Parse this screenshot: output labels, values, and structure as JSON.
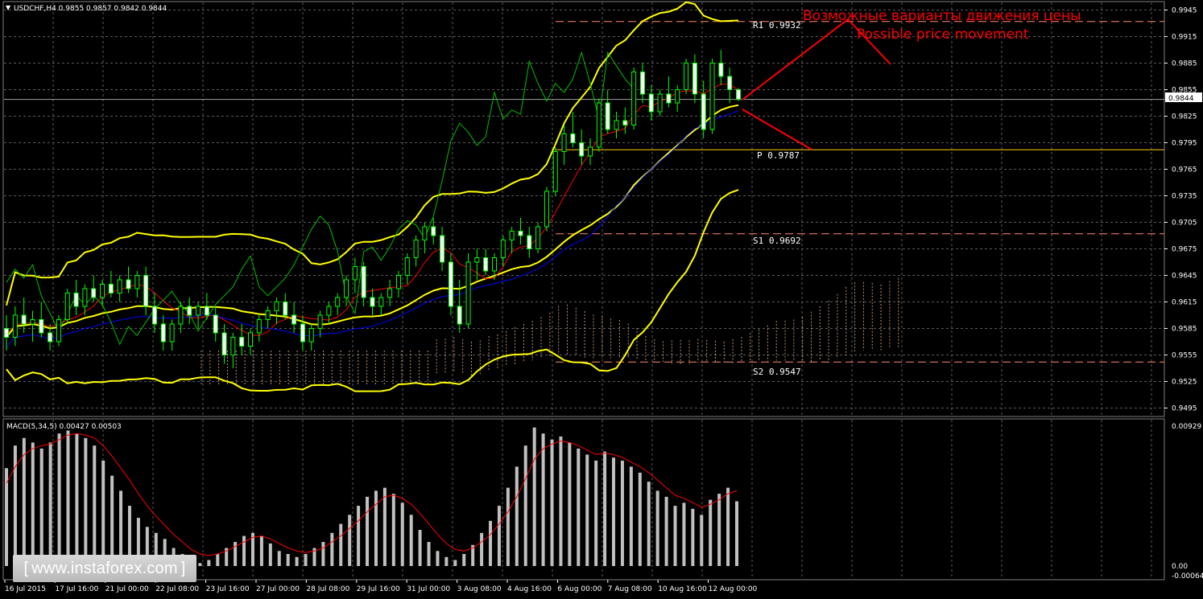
{
  "header": {
    "symbol_info": "USDCHF,H4  0.9855 0.9857 0.9842 0.9844",
    "macd_info": "MACD(5,34,5) 0.00427 0.00503"
  },
  "annotation": {
    "title_ru": "Возможные варианты движения цены",
    "title_en": "Possible price movement"
  },
  "levels": {
    "r1": "R1  0.9932",
    "p": "P  0.9787",
    "s1": "S1  0.9692",
    "s2": "S2  0.9547"
  },
  "price_axis": [
    "0.9945",
    "0.9915",
    "0.9885",
    "0.9855",
    "0.9825",
    "0.9795",
    "0.9765",
    "0.9735",
    "0.9705",
    "0.9675",
    "0.9645",
    "0.9615",
    "0.9585",
    "0.9555",
    "0.9525",
    "0.9495"
  ],
  "current_price": "0.9844",
  "macd_axis": [
    "0.00929",
    "0.00",
    "-0.00064"
  ],
  "time_axis": [
    "16 Jul 2015",
    "17 Jul 16:00",
    "21 Jul 00:00",
    "22 Jul 08:00",
    "23 Jul 16:00",
    "27 Jul 00:00",
    "28 Jul 08:00",
    "29 Jul 16:00",
    "31 Jul 00:00",
    "3 Aug 08:00",
    "4 Aug 16:00",
    "6 Aug 00:00",
    "7 Aug 08:00",
    "10 Aug 16:00",
    "12 Aug 00:00"
  ],
  "watermark": {
    "text": "www.instaforex.com",
    "open": "[",
    "close": "]"
  },
  "colors": {
    "background": "#000000",
    "bollinger": "#ffff00",
    "tenkan": "#ff0000",
    "kijun": "#0000ff",
    "chikou": "#00c000",
    "cloud": "#ffc090",
    "annotation": "#ff0000",
    "pivot": "#ffcc00",
    "macd_hist": "#c0c0c0",
    "macd_signal": "#ff0000"
  },
  "chart_data": {
    "type": "line",
    "price_range": [
      0.949,
      0.995
    ],
    "macd_range": [
      -0.00064,
      0.00929
    ],
    "pivot_levels": {
      "R1": 0.9932,
      "P": 0.9787,
      "S1": 0.9692,
      "S2": 0.9547
    },
    "current": 0.9844,
    "candles": [
      [
        0.9585,
        0.96,
        0.956,
        0.9575
      ],
      [
        0.9575,
        0.961,
        0.9565,
        0.96
      ],
      [
        0.96,
        0.962,
        0.958,
        0.959
      ],
      [
        0.959,
        0.9605,
        0.957,
        0.9595
      ],
      [
        0.9595,
        0.9615,
        0.9575,
        0.958
      ],
      [
        0.958,
        0.959,
        0.956,
        0.957
      ],
      [
        0.957,
        0.96,
        0.9565,
        0.9595
      ],
      [
        0.9595,
        0.963,
        0.959,
        0.9625
      ],
      [
        0.9625,
        0.964,
        0.96,
        0.961
      ],
      [
        0.961,
        0.9635,
        0.96,
        0.963
      ],
      [
        0.963,
        0.9645,
        0.9615,
        0.962
      ],
      [
        0.962,
        0.964,
        0.961,
        0.9635
      ],
      [
        0.9635,
        0.965,
        0.962,
        0.9625
      ],
      [
        0.9625,
        0.9645,
        0.9615,
        0.964
      ],
      [
        0.964,
        0.9655,
        0.9625,
        0.963
      ],
      [
        0.963,
        0.965,
        0.962,
        0.9645
      ],
      [
        0.9645,
        0.9655,
        0.96,
        0.961
      ],
      [
        0.961,
        0.9625,
        0.958,
        0.959
      ],
      [
        0.959,
        0.96,
        0.956,
        0.957
      ],
      [
        0.957,
        0.9595,
        0.956,
        0.959
      ],
      [
        0.959,
        0.9615,
        0.958,
        0.961
      ],
      [
        0.961,
        0.962,
        0.959,
        0.96
      ],
      [
        0.96,
        0.9615,
        0.9585,
        0.961
      ],
      [
        0.961,
        0.9625,
        0.9595,
        0.96
      ],
      [
        0.96,
        0.961,
        0.957,
        0.958
      ],
      [
        0.958,
        0.959,
        0.9545,
        0.9555
      ],
      [
        0.9555,
        0.958,
        0.954,
        0.9575
      ],
      [
        0.9575,
        0.959,
        0.9555,
        0.9565
      ],
      [
        0.9565,
        0.9585,
        0.9555,
        0.958
      ],
      [
        0.958,
        0.96,
        0.957,
        0.9595
      ],
      [
        0.9595,
        0.961,
        0.9585,
        0.9605
      ],
      [
        0.9605,
        0.962,
        0.959,
        0.9615
      ],
      [
        0.9615,
        0.9625,
        0.9595,
        0.96
      ],
      [
        0.96,
        0.9615,
        0.958,
        0.959
      ],
      [
        0.959,
        0.96,
        0.956,
        0.957
      ],
      [
        0.957,
        0.959,
        0.956,
        0.9585
      ],
      [
        0.9585,
        0.9605,
        0.9575,
        0.96
      ],
      [
        0.96,
        0.9615,
        0.959,
        0.961
      ],
      [
        0.961,
        0.9625,
        0.96,
        0.962
      ],
      [
        0.962,
        0.9645,
        0.961,
        0.964
      ],
      [
        0.964,
        0.9665,
        0.9625,
        0.9655
      ],
      [
        0.9655,
        0.966,
        0.961,
        0.962
      ],
      [
        0.962,
        0.963,
        0.96,
        0.961
      ],
      [
        0.961,
        0.9625,
        0.96,
        0.962
      ],
      [
        0.962,
        0.964,
        0.961,
        0.963
      ],
      [
        0.963,
        0.965,
        0.962,
        0.9645
      ],
      [
        0.9645,
        0.967,
        0.9635,
        0.9665
      ],
      [
        0.9665,
        0.969,
        0.9655,
        0.9685
      ],
      [
        0.9685,
        0.9705,
        0.967,
        0.97
      ],
      [
        0.97,
        0.971,
        0.968,
        0.969
      ],
      [
        0.969,
        0.97,
        0.965,
        0.966
      ],
      [
        0.966,
        0.967,
        0.96,
        0.961
      ],
      [
        0.961,
        0.964,
        0.958,
        0.959
      ],
      [
        0.959,
        0.967,
        0.9585,
        0.966
      ],
      [
        0.966,
        0.9675,
        0.964,
        0.9665
      ],
      [
        0.9665,
        0.9675,
        0.9645,
        0.965
      ],
      [
        0.965,
        0.967,
        0.964,
        0.9665
      ],
      [
        0.9665,
        0.969,
        0.9655,
        0.9685
      ],
      [
        0.9685,
        0.97,
        0.967,
        0.9695
      ],
      [
        0.9695,
        0.971,
        0.968,
        0.969
      ],
      [
        0.969,
        0.97,
        0.9665,
        0.9675
      ],
      [
        0.9675,
        0.9705,
        0.967,
        0.97
      ],
      [
        0.97,
        0.9745,
        0.9695,
        0.974
      ],
      [
        0.974,
        0.979,
        0.9735,
        0.9785
      ],
      [
        0.9785,
        0.9815,
        0.977,
        0.9805
      ],
      [
        0.9805,
        0.983,
        0.979,
        0.9795
      ],
      [
        0.9795,
        0.981,
        0.977,
        0.978
      ],
      [
        0.978,
        0.98,
        0.977,
        0.979
      ],
      [
        0.979,
        0.9845,
        0.9785,
        0.984
      ],
      [
        0.984,
        0.9855,
        0.9805,
        0.981
      ],
      [
        0.981,
        0.983,
        0.98,
        0.982
      ],
      [
        0.982,
        0.9835,
        0.9805,
        0.9815
      ],
      [
        0.9815,
        0.988,
        0.981,
        0.9875
      ],
      [
        0.9875,
        0.9885,
        0.984,
        0.985
      ],
      [
        0.985,
        0.986,
        0.982,
        0.983
      ],
      [
        0.983,
        0.9855,
        0.9825,
        0.985
      ],
      [
        0.985,
        0.987,
        0.9835,
        0.984
      ],
      [
        0.984,
        0.986,
        0.983,
        0.9855
      ],
      [
        0.9855,
        0.989,
        0.985,
        0.9885
      ],
      [
        0.9885,
        0.9895,
        0.984,
        0.985
      ],
      [
        0.985,
        0.9865,
        0.98,
        0.981
      ],
      [
        0.981,
        0.989,
        0.9805,
        0.9885
      ],
      [
        0.9885,
        0.99,
        0.986,
        0.987
      ],
      [
        0.987,
        0.988,
        0.984,
        0.9855
      ],
      [
        0.9855,
        0.9857,
        0.9842,
        0.9844
      ]
    ],
    "macd_hist": [
      0.0065,
      0.008,
      0.0085,
      0.0082,
      0.0078,
      0.0082,
      0.0088,
      0.009,
      0.0088,
      0.0085,
      0.008,
      0.007,
      0.006,
      0.005,
      0.004,
      0.0032,
      0.0026,
      0.0022,
      0.0018,
      0.0012,
      0.0008,
      0.0004,
      0.0002,
      0.0004,
      0.0008,
      0.0012,
      0.0016,
      0.002,
      0.0022,
      0.002,
      0.0015,
      0.001,
      0.0008,
      0.0006,
      0.0008,
      0.0012,
      0.0016,
      0.0022,
      0.0028,
      0.0034,
      0.004,
      0.0046,
      0.005,
      0.0052,
      0.0048,
      0.0042,
      0.0034,
      0.0024,
      0.0016,
      0.001,
      0.0006,
      0.0004,
      0.0008,
      0.0014,
      0.0022,
      0.003,
      0.004,
      0.0052,
      0.0066,
      0.008,
      0.0092,
      0.0088,
      0.0084,
      0.0086,
      0.0082,
      0.0078,
      0.0074,
      0.007,
      0.0076,
      0.0072,
      0.007,
      0.0066,
      0.0062,
      0.0056,
      0.005,
      0.0046,
      0.004,
      0.0042,
      0.0038,
      0.0034,
      0.0044,
      0.0048,
      0.0052,
      0.0043
    ],
    "macd_signal": [
      0.0055,
      0.0066,
      0.0074,
      0.0078,
      0.008,
      0.0081,
      0.0084,
      0.0087,
      0.0088,
      0.0087,
      0.0085,
      0.008,
      0.0073,
      0.0065,
      0.0057,
      0.0048,
      0.004,
      0.0033,
      0.0027,
      0.0021,
      0.0016,
      0.0011,
      0.0008,
      0.0007,
      0.0008,
      0.001,
      0.0013,
      0.0016,
      0.0019,
      0.002,
      0.0018,
      0.0015,
      0.0012,
      0.001,
      0.0009,
      0.001,
      0.0012,
      0.0016,
      0.002,
      0.0025,
      0.003,
      0.0036,
      0.0041,
      0.0046,
      0.0047,
      0.0045,
      0.0041,
      0.0035,
      0.0028,
      0.0021,
      0.0015,
      0.0011,
      0.001,
      0.0012,
      0.0016,
      0.0021,
      0.0028,
      0.0036,
      0.0046,
      0.0058,
      0.0071,
      0.0078,
      0.0081,
      0.0083,
      0.0082,
      0.008,
      0.0077,
      0.0074,
      0.0075,
      0.0074,
      0.0072,
      0.0069,
      0.0066,
      0.0062,
      0.0057,
      0.0052,
      0.0047,
      0.0045,
      0.0042,
      0.0039,
      0.0041,
      0.0044,
      0.0048,
      0.005
    ]
  }
}
